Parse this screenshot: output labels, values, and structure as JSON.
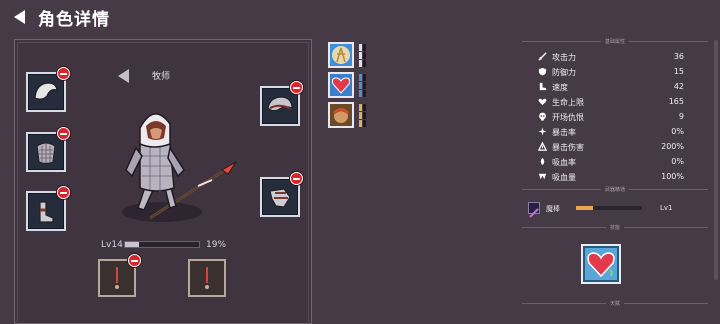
{
  "header": {
    "title": "角色详情"
  },
  "character": {
    "class_name": "牧师",
    "level": "Lv14",
    "exp_percent_text": "19%",
    "exp_fraction": 0.19
  },
  "equipment_slots": [
    {
      "side": "left",
      "item": "helmet"
    },
    {
      "side": "left",
      "item": "chainmail"
    },
    {
      "side": "left",
      "item": "boots"
    },
    {
      "side": "right",
      "item": "helmet-right"
    },
    {
      "side": "right",
      "item": "gauntlet"
    }
  ],
  "accessory_slots": [
    {
      "item": "amulet"
    },
    {
      "item": "amulet"
    }
  ],
  "portraits": [
    {
      "icon": "warrior-portrait",
      "pip_color": "#e0e0e0"
    },
    {
      "icon": "heart-portrait",
      "pip_color": "#4a8fd0"
    },
    {
      "icon": "tribal-portrait",
      "pip_color": "#d8b060"
    }
  ],
  "stats_section": {
    "title": "基础属性",
    "rows": [
      {
        "icon": "sword-icon",
        "label": "攻击力",
        "value": "36"
      },
      {
        "icon": "shield-icon",
        "label": "防御力",
        "value": "15"
      },
      {
        "icon": "boot-icon",
        "label": "速度",
        "value": "42"
      },
      {
        "icon": "heart-icon",
        "label": "生命上限",
        "value": "165"
      },
      {
        "icon": "skull-icon",
        "label": "开场仇恨",
        "value": "9"
      },
      {
        "icon": "crit-icon",
        "label": "暴击率",
        "value": "0%"
      },
      {
        "icon": "crit-damage-icon",
        "label": "暴击伤害",
        "value": "200%"
      },
      {
        "icon": "lifesteal-icon",
        "label": "吸血率",
        "value": "0%"
      },
      {
        "icon": "fang-icon",
        "label": "吸血量",
        "value": "100%"
      }
    ]
  },
  "weapon_section": {
    "title": "武器精通",
    "weapon_name": "魔棒",
    "weapon_level": "Lv1",
    "progress_fraction": 0.25
  },
  "skill_section": {
    "title": "技能",
    "skill_icon": "heart-skill-icon"
  },
  "talent_section": {
    "title": "天赋"
  },
  "colors": {
    "background": "#463a47",
    "remove_badge": "#d8242d",
    "slot_bg": "#252c3c",
    "progress_orange": "#e8a64c"
  }
}
